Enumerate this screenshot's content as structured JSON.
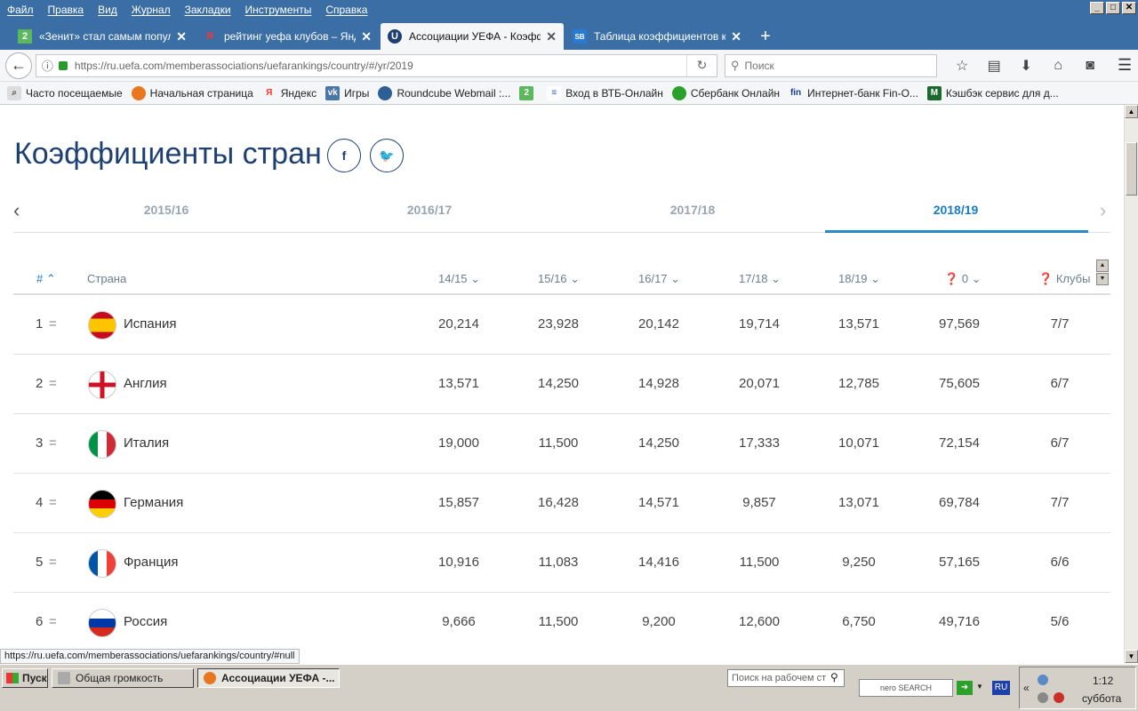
{
  "menu": [
    "Файл",
    "Правка",
    "Вид",
    "Журнал",
    "Закладки",
    "Инструменты",
    "Справка"
  ],
  "tabs": [
    {
      "label": "«Зенит» стал самым популя...",
      "icon": "2"
    },
    {
      "label": "рейтинг уефа клубов – Янде...",
      "icon": "Я"
    },
    {
      "label": "Ассоциации УЕФА - Коэфф...",
      "icon": "U"
    },
    {
      "label": "Таблица коэффициентов кл...",
      "icon": "SB"
    }
  ],
  "nav": {
    "url": "https://ru.uefa.com/memberassociations/uefarankings/country/#/yr/2019",
    "search_placeholder": "Поиск"
  },
  "bookmarks": [
    "Часто посещаемые",
    "Начальная страница",
    "Яндекс",
    "Игры",
    "Roundcube Webmail :...",
    "",
    "Вход в ВТБ-Онлайн",
    "Сбербанк Онлайн",
    "Интернет-банк Fin-O...",
    "Кэшбэк сервис для д..."
  ],
  "page": {
    "title": "Коэффициенты стран",
    "seasons": [
      "2015/16",
      "2016/17",
      "2017/18",
      "2018/19"
    ],
    "active_season": "2018/19",
    "columns": {
      "rank": "#",
      "country": "Страна",
      "s1": "14/15",
      "s2": "15/16",
      "s3": "16/17",
      "s4": "17/18",
      "s5": "18/19",
      "total": "0",
      "clubs": "Клубы"
    },
    "rows": [
      {
        "rank": "1",
        "eq": "=",
        "country": "Испания",
        "v": [
          "20,214",
          "23,928",
          "20,142",
          "19,714",
          "13,571",
          "97,569",
          "7/7"
        ]
      },
      {
        "rank": "2",
        "eq": "=",
        "country": "Англия",
        "v": [
          "13,571",
          "14,250",
          "14,928",
          "20,071",
          "12,785",
          "75,605",
          "6/7"
        ]
      },
      {
        "rank": "3",
        "eq": "=",
        "country": "Италия",
        "v": [
          "19,000",
          "11,500",
          "14,250",
          "17,333",
          "10,071",
          "72,154",
          "6/7"
        ]
      },
      {
        "rank": "4",
        "eq": "=",
        "country": "Германия",
        "v": [
          "15,857",
          "16,428",
          "14,571",
          "9,857",
          "13,071",
          "69,784",
          "7/7"
        ]
      },
      {
        "rank": "5",
        "eq": "=",
        "country": "Франция",
        "v": [
          "10,916",
          "11,083",
          "14,416",
          "11,500",
          "9,250",
          "57,165",
          "6/6"
        ]
      },
      {
        "rank": "6",
        "eq": "=",
        "country": "Россия",
        "v": [
          "9,666",
          "11,500",
          "9,200",
          "12,600",
          "6,750",
          "49,716",
          "5/6"
        ]
      }
    ]
  },
  "status_url": "https://ru.uefa.com/memberassociations/uefarankings/country/#null",
  "taskbar": {
    "start": "Пуск",
    "buttons": [
      "Общая громкость",
      "Ассоциации УЕФА -..."
    ],
    "desk_search": "Поиск на рабочем ст",
    "nero": "nero SEARCH",
    "lang": "RU",
    "time": "1:12",
    "day": "суббота"
  }
}
